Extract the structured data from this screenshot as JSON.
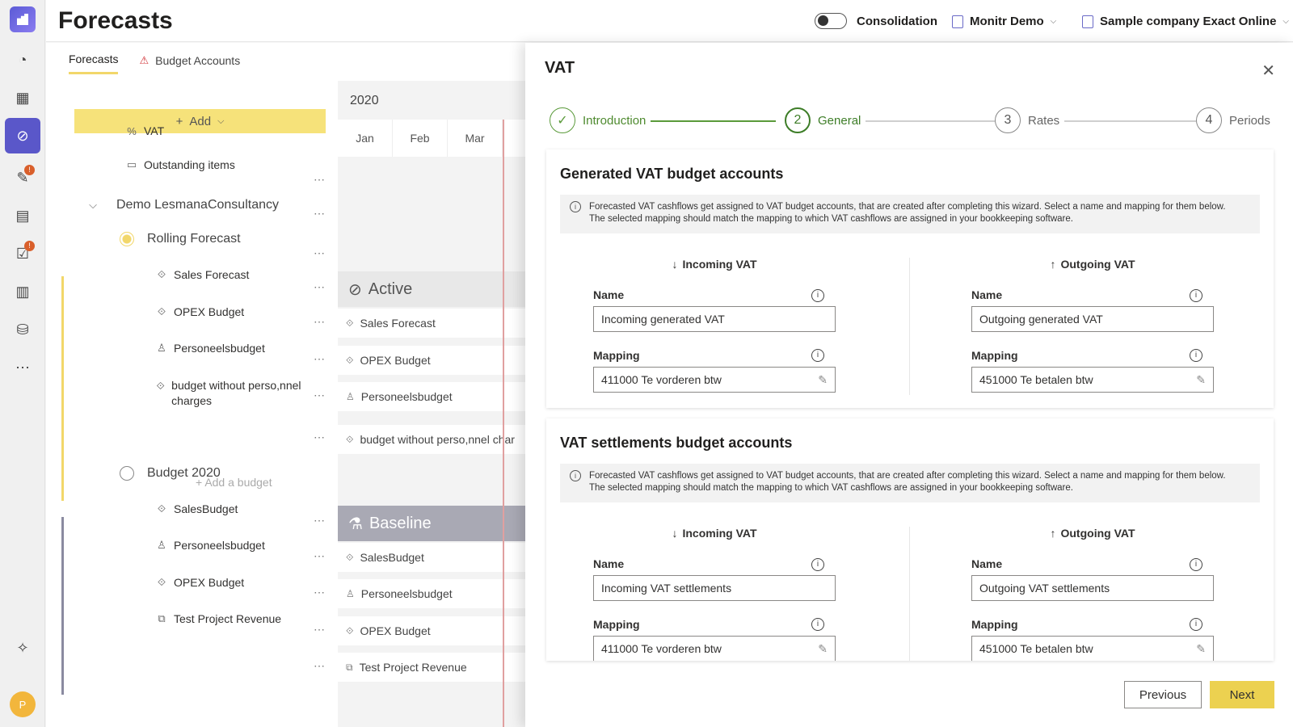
{
  "app": {
    "title": "Forecasts"
  },
  "header": {
    "consolidation_label": "Consolidation",
    "org_selector": "Monitr Demo",
    "company_selector": "Sample company Exact Online"
  },
  "tabs": [
    {
      "label": "Forecasts"
    },
    {
      "label": "Budget Accounts"
    }
  ],
  "add_button": "Add",
  "tree": {
    "items_top": [
      {
        "label": "VAT",
        "icon": "percent-icon"
      },
      {
        "label": "Outstanding items",
        "icon": "calendar-icon"
      }
    ],
    "group": "Demo LesmanaConsultancy",
    "rolling": {
      "label": "Rolling Forecast",
      "budgets": [
        "Sales Forecast",
        "OPEX Budget",
        "Personeelsbudget",
        "budget without perso,nnel charges"
      ],
      "add_budget": "Add a budget"
    },
    "budget2020": {
      "label": "Budget 2020",
      "budgets": [
        "SalesBudget",
        "Personeelsbudget",
        "OPEX Budget",
        "Test Project Revenue"
      ]
    }
  },
  "timeline": {
    "year": "2020",
    "months": [
      "Jan",
      "Feb",
      "Mar"
    ],
    "active_label": "Active",
    "baseline_label": "Baseline",
    "active_rows": [
      "Sales Forecast",
      "OPEX Budget",
      "Personeelsbudget",
      "budget without perso,nnel char"
    ],
    "baseline_rows": [
      "SalesBudget",
      "Personeelsbudget",
      "OPEX Budget",
      "Test Project Revenue"
    ]
  },
  "panel": {
    "title": "VAT",
    "steps": [
      {
        "num": "✓",
        "label": "Introduction"
      },
      {
        "num": "2",
        "label": "General"
      },
      {
        "num": "3",
        "label": "Rates"
      },
      {
        "num": "4",
        "label": "Periods"
      }
    ],
    "note_line1": "Forecasted VAT cashflows get assigned to VAT budget accounts, that are created after completing this wizard. Select a name and mapping for them below.",
    "note_line2": "The selected mapping should match the mapping to which VAT cashflows are assigned in your bookkeeping software.",
    "name_label": "Name",
    "mapping_label": "Mapping",
    "incoming_label": "Incoming VAT",
    "outgoing_label": "Outgoing VAT",
    "generated": {
      "title": "Generated VAT budget accounts",
      "incoming_name": "Incoming generated VAT",
      "incoming_mapping": "411000 Te vorderen btw",
      "outgoing_name": "Outgoing generated VAT",
      "outgoing_mapping": "451000 Te betalen btw"
    },
    "settlements": {
      "title": "VAT settlements budget accounts",
      "incoming_name": "Incoming VAT settlements",
      "incoming_mapping": "411000 Te vorderen btw",
      "outgoing_name": "Outgoing VAT settlements",
      "outgoing_mapping": "451000 Te betalen btw"
    },
    "previous_button": "Previous",
    "next_button": "Next"
  },
  "user": {
    "initial": "P"
  },
  "colors": {
    "accent": "#f6e27a",
    "primary": "#5a57c9",
    "success": "#3d7d27"
  }
}
